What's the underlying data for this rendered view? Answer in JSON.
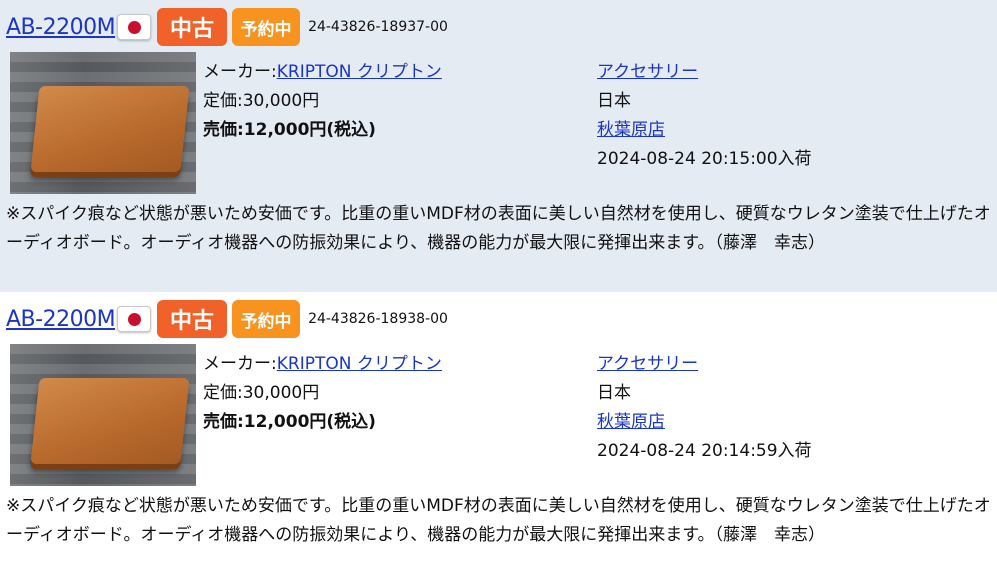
{
  "listings": [
    {
      "model": "AB-2200M",
      "country_flag": "japan-flag",
      "badge_used": "中古",
      "badge_reserve": "予約中",
      "code": "24-43826-18937-00",
      "maker_label": "メーカー:",
      "maker_name": "KRIPTON クリプトン",
      "list_price": "定価:30,000円",
      "sale_price": "売価:12,000円(税込)",
      "category": "アクセサリー",
      "origin": "日本",
      "store": "秋葉原店",
      "arrival": "2024-08-24 20:15:00入荷",
      "description": "※スパイク痕など状態が悪いため安価です。比重の重いMDF材の表面に美しい自然材を使用し、硬質なウレタン塗装で仕上げたオーディオボード。オーディオ機器への防振効果により、機器の能力が最大限に発揮出来ます。（藤澤　幸志）"
    },
    {
      "model": "AB-2200M",
      "country_flag": "japan-flag",
      "badge_used": "中古",
      "badge_reserve": "予約中",
      "code": "24-43826-18938-00",
      "maker_label": "メーカー:",
      "maker_name": "KRIPTON クリプトン",
      "list_price": "定価:30,000円",
      "sale_price": "売価:12,000円(税込)",
      "category": "アクセサリー",
      "origin": "日本",
      "store": "秋葉原店",
      "arrival": "2024-08-24 20:14:59入荷",
      "description": "※スパイク痕など状態が悪いため安価です。比重の重いMDF材の表面に美しい自然材を使用し、硬質なウレタン塗装で仕上げたオーディオボード。オーディオ機器への防振効果により、機器の能力が最大限に発揮出来ます。（藤澤　幸志）"
    }
  ],
  "colors": {
    "shaded_row": "#e4ebf3",
    "link": "#1a35c8",
    "badge_used": "#f0622a",
    "badge_reserve": "#f7931e"
  }
}
